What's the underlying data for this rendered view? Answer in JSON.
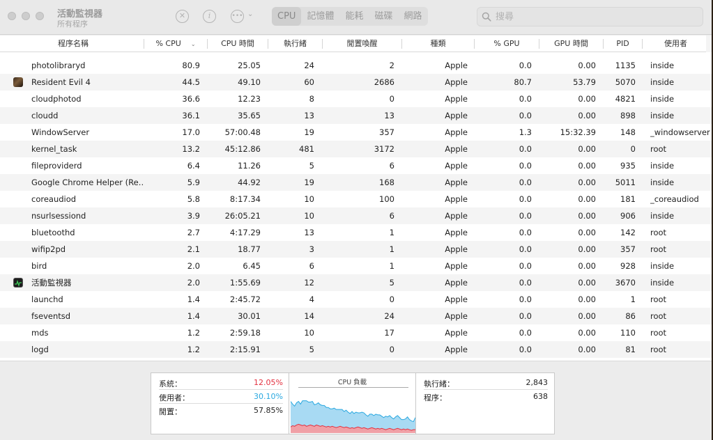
{
  "window": {
    "title": "活動監視器",
    "subtitle": "所有程序"
  },
  "toolbar": {
    "stop_icon": "stop-x-icon",
    "info_icon": "info-icon",
    "action_icon": "ellipsis-menu-icon",
    "tabs": [
      "CPU",
      "記憶體",
      "能耗",
      "磁碟",
      "網路"
    ],
    "active_tab": "CPU",
    "search_placeholder": "搜尋"
  },
  "table": {
    "columns": [
      "程序名稱",
      "% CPU",
      "CPU 時間",
      "執行緒",
      "閒置喚醒",
      "種類",
      "% GPU",
      "GPU 時間",
      "PID",
      "使用者"
    ],
    "sorted_column": "% CPU",
    "rows": [
      {
        "name": "photolibraryd",
        "icon": "",
        "cpu": "80.9",
        "cpu_time": "25.05",
        "threads": "24",
        "idle_wakeups": "2",
        "kind": "Apple",
        "gpu": "0.0",
        "gpu_time": "0.00",
        "pid": "1135",
        "user": "inside"
      },
      {
        "name": "Resident Evil 4",
        "icon": "resident-evil-app-icon",
        "cpu": "44.5",
        "cpu_time": "49.10",
        "threads": "60",
        "idle_wakeups": "2686",
        "kind": "Apple",
        "gpu": "80.7",
        "gpu_time": "53.79",
        "pid": "5070",
        "user": "inside"
      },
      {
        "name": "cloudphotod",
        "icon": "",
        "cpu": "36.6",
        "cpu_time": "12.23",
        "threads": "8",
        "idle_wakeups": "0",
        "kind": "Apple",
        "gpu": "0.0",
        "gpu_time": "0.00",
        "pid": "4821",
        "user": "inside"
      },
      {
        "name": "cloudd",
        "icon": "",
        "cpu": "36.1",
        "cpu_time": "35.65",
        "threads": "13",
        "idle_wakeups": "13",
        "kind": "Apple",
        "gpu": "0.0",
        "gpu_time": "0.00",
        "pid": "898",
        "user": "inside"
      },
      {
        "name": "WindowServer",
        "icon": "",
        "cpu": "17.0",
        "cpu_time": "57:00.48",
        "threads": "19",
        "idle_wakeups": "357",
        "kind": "Apple",
        "gpu": "1.3",
        "gpu_time": "15:32.39",
        "pid": "148",
        "user": "_windowserver"
      },
      {
        "name": "kernel_task",
        "icon": "",
        "cpu": "13.2",
        "cpu_time": "45:12.86",
        "threads": "481",
        "idle_wakeups": "3172",
        "kind": "Apple",
        "gpu": "0.0",
        "gpu_time": "0.00",
        "pid": "0",
        "user": "root"
      },
      {
        "name": "fileproviderd",
        "icon": "",
        "cpu": "6.4",
        "cpu_time": "11.26",
        "threads": "5",
        "idle_wakeups": "6",
        "kind": "Apple",
        "gpu": "0.0",
        "gpu_time": "0.00",
        "pid": "935",
        "user": "inside"
      },
      {
        "name": "Google Chrome Helper (Re…",
        "icon": "",
        "cpu": "5.9",
        "cpu_time": "44.92",
        "threads": "19",
        "idle_wakeups": "168",
        "kind": "Apple",
        "gpu": "0.0",
        "gpu_time": "0.00",
        "pid": "5011",
        "user": "inside"
      },
      {
        "name": "coreaudiod",
        "icon": "",
        "cpu": "5.8",
        "cpu_time": "8:17.34",
        "threads": "10",
        "idle_wakeups": "100",
        "kind": "Apple",
        "gpu": "0.0",
        "gpu_time": "0.00",
        "pid": "181",
        "user": "_coreaudiod"
      },
      {
        "name": "nsurlsessiond",
        "icon": "",
        "cpu": "3.9",
        "cpu_time": "26:05.21",
        "threads": "10",
        "idle_wakeups": "6",
        "kind": "Apple",
        "gpu": "0.0",
        "gpu_time": "0.00",
        "pid": "906",
        "user": "inside"
      },
      {
        "name": "bluetoothd",
        "icon": "",
        "cpu": "2.7",
        "cpu_time": "4:17.29",
        "threads": "13",
        "idle_wakeups": "1",
        "kind": "Apple",
        "gpu": "0.0",
        "gpu_time": "0.00",
        "pid": "142",
        "user": "root"
      },
      {
        "name": "wifip2pd",
        "icon": "",
        "cpu": "2.1",
        "cpu_time": "18.77",
        "threads": "3",
        "idle_wakeups": "1",
        "kind": "Apple",
        "gpu": "0.0",
        "gpu_time": "0.00",
        "pid": "357",
        "user": "root"
      },
      {
        "name": "bird",
        "icon": "",
        "cpu": "2.0",
        "cpu_time": "6.45",
        "threads": "6",
        "idle_wakeups": "1",
        "kind": "Apple",
        "gpu": "0.0",
        "gpu_time": "0.00",
        "pid": "928",
        "user": "inside"
      },
      {
        "name": "活動監視器",
        "icon": "activity-monitor-app-icon",
        "cpu": "2.0",
        "cpu_time": "1:55.69",
        "threads": "12",
        "idle_wakeups": "5",
        "kind": "Apple",
        "gpu": "0.0",
        "gpu_time": "0.00",
        "pid": "3670",
        "user": "inside"
      },
      {
        "name": "launchd",
        "icon": "",
        "cpu": "1.4",
        "cpu_time": "2:45.72",
        "threads": "4",
        "idle_wakeups": "0",
        "kind": "Apple",
        "gpu": "0.0",
        "gpu_time": "0.00",
        "pid": "1",
        "user": "root"
      },
      {
        "name": "fseventsd",
        "icon": "",
        "cpu": "1.4",
        "cpu_time": "30.01",
        "threads": "14",
        "idle_wakeups": "24",
        "kind": "Apple",
        "gpu": "0.0",
        "gpu_time": "0.00",
        "pid": "86",
        "user": "root"
      },
      {
        "name": "mds",
        "icon": "",
        "cpu": "1.2",
        "cpu_time": "2:59.18",
        "threads": "10",
        "idle_wakeups": "17",
        "kind": "Apple",
        "gpu": "0.0",
        "gpu_time": "0.00",
        "pid": "110",
        "user": "root"
      },
      {
        "name": "logd",
        "icon": "",
        "cpu": "1.2",
        "cpu_time": "2:15.91",
        "threads": "5",
        "idle_wakeups": "0",
        "kind": "Apple",
        "gpu": "0.0",
        "gpu_time": "0.00",
        "pid": "81",
        "user": "root"
      }
    ]
  },
  "footer": {
    "system_label": "系統：",
    "system_value": "12.05%",
    "user_label": "使用者：",
    "user_value": "30.10%",
    "idle_label": "閒置：",
    "idle_value": "57.85%",
    "graph_title": "CPU 負載",
    "threads_label": "執行緒：",
    "threads_value": "2,843",
    "processes_label": "程序：",
    "processes_value": "638"
  },
  "colors": {
    "system": "#e3303f",
    "user": "#29a8e0",
    "graph_user_fill": "#a8daf3",
    "graph_system_fill": "#f0a0a6"
  },
  "cpu_load_history": {
    "user_pct": [
      38,
      32,
      30,
      33,
      34,
      31,
      37,
      36,
      38,
      35,
      34,
      36,
      32,
      31,
      34,
      32,
      30,
      31,
      29,
      28,
      27,
      26,
      28,
      27,
      26,
      25,
      26,
      24,
      25,
      23,
      22,
      24,
      22,
      23,
      21,
      22,
      24,
      22,
      20,
      19,
      21,
      20,
      19,
      22,
      20,
      21,
      18,
      17,
      20,
      18,
      19,
      17,
      16,
      18,
      19,
      17,
      15,
      14,
      16,
      18,
      15,
      14,
      12,
      18
    ],
    "system_pct": [
      9,
      11,
      10,
      12,
      13,
      12,
      11,
      12,
      10,
      11,
      12,
      11,
      10,
      12,
      11,
      10,
      11,
      10,
      9,
      10,
      9,
      10,
      9,
      8,
      9,
      10,
      9,
      8,
      9,
      8,
      7,
      8,
      7,
      8,
      9,
      8,
      7,
      8,
      7,
      6,
      7,
      8,
      7,
      6,
      7,
      6,
      7,
      6,
      5,
      6,
      7,
      6,
      5,
      6,
      7,
      6,
      5,
      6,
      5,
      6,
      5,
      4,
      5,
      5
    ]
  }
}
